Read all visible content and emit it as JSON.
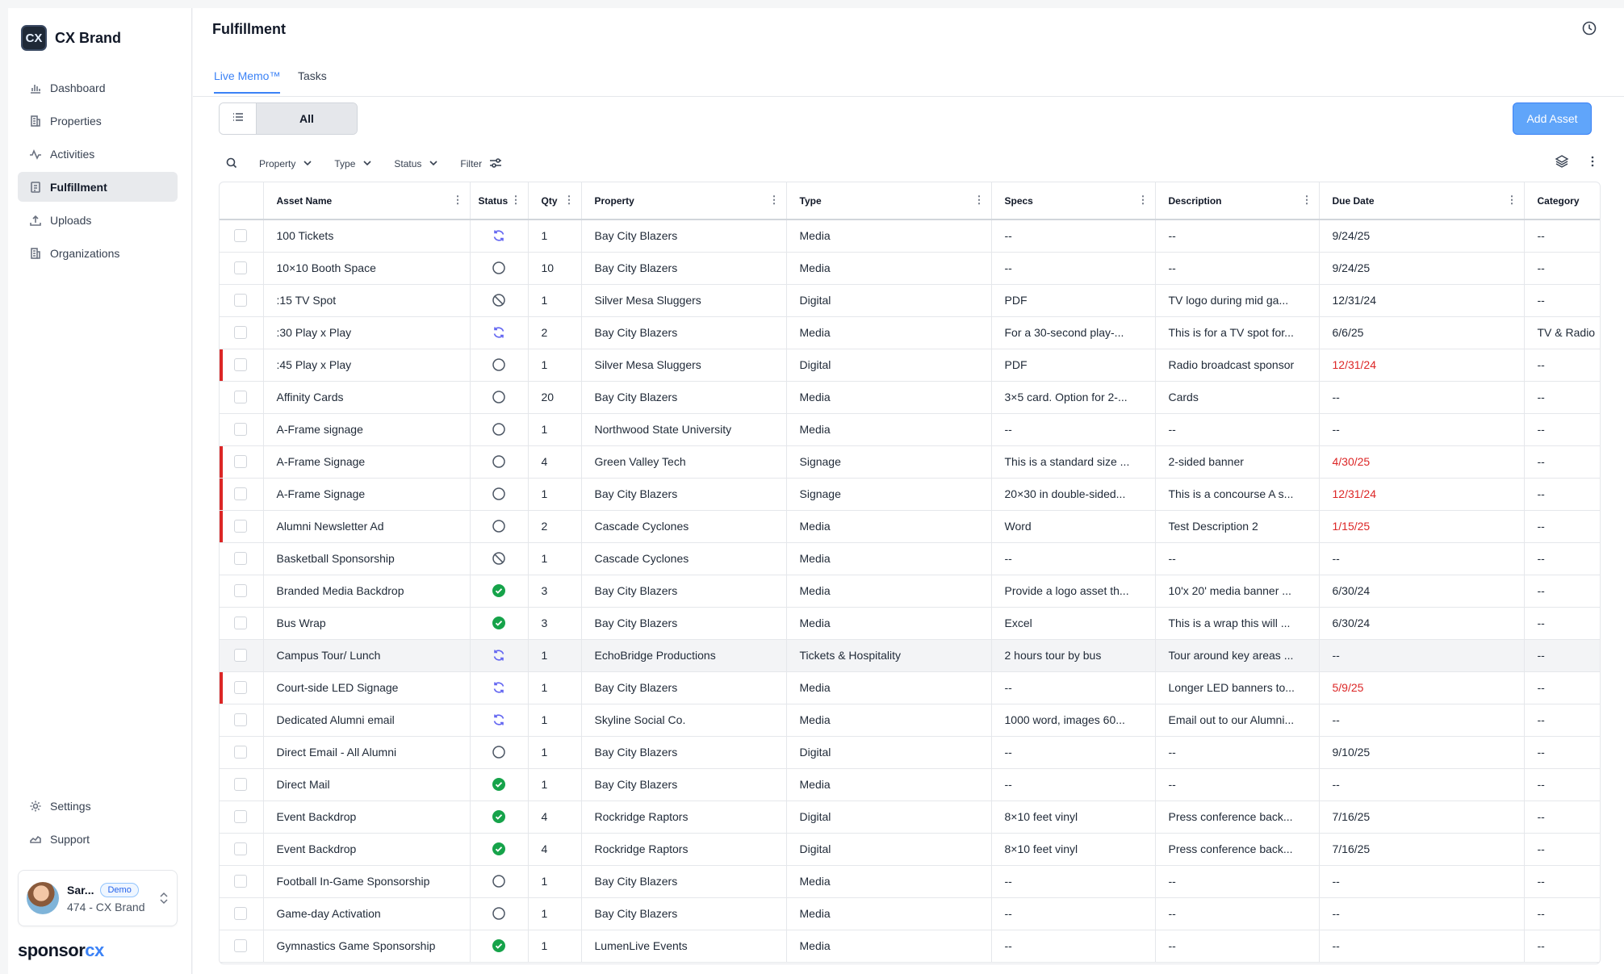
{
  "brand": {
    "logo_text": "CX",
    "name": "CX Brand"
  },
  "nav": {
    "items": [
      {
        "label": "Dashboard",
        "icon": "bar-chart-icon"
      },
      {
        "label": "Properties",
        "icon": "building-icon"
      },
      {
        "label": "Activities",
        "icon": "activity-icon"
      },
      {
        "label": "Fulfillment",
        "icon": "clipboard-icon"
      },
      {
        "label": "Uploads",
        "icon": "upload-icon"
      },
      {
        "label": "Organizations",
        "icon": "building-icon"
      }
    ],
    "active": "Fulfillment",
    "bottom": [
      {
        "label": "Settings",
        "icon": "gear-icon"
      },
      {
        "label": "Support",
        "icon": "support-icon"
      }
    ]
  },
  "user": {
    "name": "Sar...",
    "badge": "Demo",
    "org": "474 - CX Brand"
  },
  "footer_logo": {
    "main": "sponsor",
    "accent": "cx"
  },
  "page": {
    "title": "Fulfillment"
  },
  "tabs": [
    {
      "label": "Live Memo™",
      "active": true
    },
    {
      "label": "Tasks",
      "active": false
    }
  ],
  "toolbar": {
    "view_all": "All",
    "add_asset": "Add Asset"
  },
  "filters": {
    "property": "Property",
    "type": "Type",
    "status": "Status",
    "filter": "Filter"
  },
  "table": {
    "columns": [
      "",
      "Asset Name",
      "Status",
      "Qty",
      "Property",
      "Type",
      "Specs",
      "Description",
      "Due Date",
      "Category"
    ],
    "rows": [
      {
        "flag": false,
        "name": "100 Tickets",
        "status": "in-progress",
        "qty": "1",
        "property": "Bay City Blazers",
        "type": "Media",
        "specs": "--",
        "description": "--",
        "due": "9/24/25",
        "overdue": false,
        "category": "--"
      },
      {
        "flag": false,
        "name": "10×10 Booth Space",
        "status": "not-started",
        "qty": "10",
        "property": "Bay City Blazers",
        "type": "Media",
        "specs": "--",
        "description": "--",
        "due": "9/24/25",
        "overdue": false,
        "category": "--"
      },
      {
        "flag": false,
        "name": ":15 TV Spot",
        "status": "blocked",
        "qty": "1",
        "property": "Silver Mesa Sluggers",
        "type": "Digital",
        "specs": "PDF",
        "description": "TV logo during mid ga...",
        "due": "12/31/24",
        "overdue": false,
        "category": "--"
      },
      {
        "flag": false,
        "name": ":30 Play x Play",
        "status": "in-progress",
        "qty": "2",
        "property": "Bay City Blazers",
        "type": "Media",
        "specs": "For a 30-second play-...",
        "description": "This is for a TV spot for...",
        "due": "6/6/25",
        "overdue": false,
        "category": "TV & Radio"
      },
      {
        "flag": true,
        "name": ":45 Play x Play",
        "status": "not-started",
        "qty": "1",
        "property": "Silver Mesa Sluggers",
        "type": "Digital",
        "specs": "PDF",
        "description": "Radio broadcast sponsor",
        "due": "12/31/24",
        "overdue": true,
        "category": "--"
      },
      {
        "flag": false,
        "name": "Affinity Cards",
        "status": "not-started",
        "qty": "20",
        "property": "Bay City Blazers",
        "type": "Media",
        "specs": "3×5 card. Option for 2-...",
        "description": "Cards",
        "due": "--",
        "overdue": false,
        "category": "--"
      },
      {
        "flag": false,
        "name": "A-Frame signage",
        "status": "not-started",
        "qty": "1",
        "property": "Northwood State University",
        "type": "Media",
        "specs": "--",
        "description": "--",
        "due": "--",
        "overdue": false,
        "category": "--"
      },
      {
        "flag": true,
        "name": "A-Frame Signage",
        "status": "not-started",
        "qty": "4",
        "property": "Green Valley Tech",
        "type": "Signage",
        "specs": "This is a standard size ...",
        "description": "2-sided banner",
        "due": "4/30/25",
        "overdue": true,
        "category": "--"
      },
      {
        "flag": true,
        "name": "A-Frame Signage",
        "status": "not-started",
        "qty": "1",
        "property": "Bay City Blazers",
        "type": "Signage",
        "specs": "20×30 in double-sided...",
        "description": "This is a concourse A s...",
        "due": "12/31/24",
        "overdue": true,
        "category": "--"
      },
      {
        "flag": true,
        "name": "Alumni Newsletter Ad",
        "status": "not-started",
        "qty": "2",
        "property": "Cascade Cyclones",
        "type": "Media",
        "specs": "Word",
        "description": "Test Description 2",
        "due": "1/15/25",
        "overdue": true,
        "category": "--"
      },
      {
        "flag": false,
        "name": "Basketball Sponsorship",
        "status": "blocked",
        "qty": "1",
        "property": "Cascade Cyclones",
        "type": "Media",
        "specs": "--",
        "description": "--",
        "due": "--",
        "overdue": false,
        "category": "--"
      },
      {
        "flag": false,
        "name": "Branded Media Backdrop",
        "status": "complete",
        "qty": "3",
        "property": "Bay City Blazers",
        "type": "Media",
        "specs": "Provide a logo asset th...",
        "description": "10'x 20' media banner ...",
        "due": "6/30/24",
        "overdue": false,
        "category": "--"
      },
      {
        "flag": false,
        "name": "Bus Wrap",
        "status": "complete",
        "qty": "3",
        "property": "Bay City Blazers",
        "type": "Media",
        "specs": "Excel",
        "description": "This is a wrap this will ...",
        "due": "6/30/24",
        "overdue": false,
        "category": "--"
      },
      {
        "flag": false,
        "highlight": true,
        "name": "Campus Tour/ Lunch",
        "status": "in-progress",
        "qty": "1",
        "property": "EchoBridge Productions",
        "type": "Tickets & Hospitality",
        "specs": "2 hours tour by bus",
        "description": "Tour around key areas ...",
        "due": "--",
        "overdue": false,
        "category": "--"
      },
      {
        "flag": true,
        "name": "Court-side LED Signage",
        "status": "in-progress",
        "qty": "1",
        "property": "Bay City Blazers",
        "type": "Media",
        "specs": "--",
        "description": "Longer LED banners to...",
        "due": "5/9/25",
        "overdue": true,
        "category": "--"
      },
      {
        "flag": false,
        "name": "Dedicated Alumni email",
        "status": "in-progress",
        "qty": "1",
        "property": "Skyline Social Co.",
        "type": "Media",
        "specs": "1000 word, images 60...",
        "description": "Email out to our Alumni...",
        "due": "--",
        "overdue": false,
        "category": "--"
      },
      {
        "flag": false,
        "name": "Direct Email - All Alumni",
        "status": "not-started",
        "qty": "1",
        "property": "Bay City Blazers",
        "type": "Digital",
        "specs": "--",
        "description": "--",
        "due": "9/10/25",
        "overdue": false,
        "category": "--"
      },
      {
        "flag": false,
        "name": "Direct Mail",
        "status": "complete",
        "qty": "1",
        "property": "Bay City Blazers",
        "type": "Media",
        "specs": "--",
        "description": "--",
        "due": "--",
        "overdue": false,
        "category": "--"
      },
      {
        "flag": false,
        "name": "Event Backdrop",
        "status": "complete",
        "qty": "4",
        "property": "Rockridge Raptors",
        "type": "Digital",
        "specs": "8×10 feet vinyl",
        "description": "Press conference back...",
        "due": "7/16/25",
        "overdue": false,
        "category": "--"
      },
      {
        "flag": false,
        "name": "Event Backdrop",
        "status": "complete",
        "qty": "4",
        "property": "Rockridge Raptors",
        "type": "Digital",
        "specs": "8×10 feet vinyl",
        "description": "Press conference back...",
        "due": "7/16/25",
        "overdue": false,
        "category": "--"
      },
      {
        "flag": false,
        "name": "Football In-Game Sponsorship",
        "status": "not-started",
        "qty": "1",
        "property": "Bay City Blazers",
        "type": "Media",
        "specs": "--",
        "description": "--",
        "due": "--",
        "overdue": false,
        "category": "--"
      },
      {
        "flag": false,
        "name": "Game-day Activation",
        "status": "not-started",
        "qty": "1",
        "property": "Bay City Blazers",
        "type": "Media",
        "specs": "--",
        "description": "--",
        "due": "--",
        "overdue": false,
        "category": "--"
      },
      {
        "flag": false,
        "name": "Gymnastics Game Sponsorship",
        "status": "complete",
        "qty": "1",
        "property": "LumenLive Events",
        "type": "Media",
        "specs": "--",
        "description": "--",
        "due": "--",
        "overdue": false,
        "category": "--"
      }
    ]
  },
  "colors": {
    "accent": "#3b82f6",
    "overdue": "#dc2626",
    "complete": "#16a34a",
    "in_progress": "#6366f1"
  }
}
